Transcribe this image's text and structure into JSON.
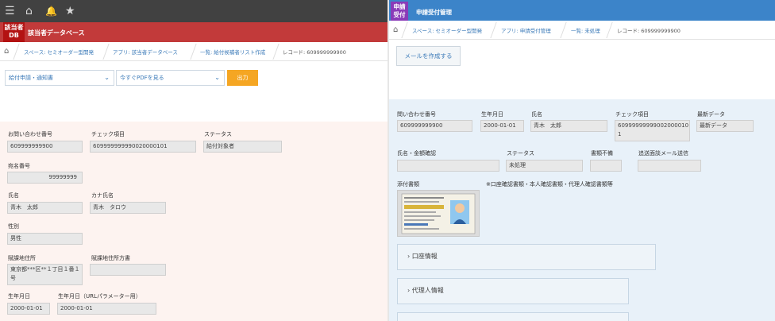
{
  "left": {
    "topbar": {
      "icons": [
        "menu-icon",
        "home-icon",
        "bell-icon",
        "star-icon"
      ],
      "glyphs": [
        "☰",
        "⌂",
        "🔔",
        "★"
      ]
    },
    "app": {
      "icon_line1": "該当者",
      "icon_line2": "DB",
      "title": "該当者データベース"
    },
    "breadcrumb": [
      "スペース: セミオーダー型開発",
      "アプリ: 該当者データベース",
      "一覧: 給付候補者リスト作成",
      "レコード: 609999999900"
    ],
    "controls": {
      "select1": "給付申請・通知書",
      "select2": "今すぐPDFを見る",
      "output_button": "出力"
    },
    "fields": {
      "inquiry_no": {
        "label": "お問い合わせ番号",
        "value": "609999999900"
      },
      "check_item": {
        "label": "チェック項目",
        "value": "609999999990020000101"
      },
      "status": {
        "label": "ステータス",
        "value": "給付対象者"
      },
      "address_no": {
        "label": "宛名番号",
        "value": "99999999"
      },
      "name": {
        "label": "氏名",
        "value": "青木　太郎"
      },
      "kana": {
        "label": "カナ氏名",
        "value": "青木　タロウ"
      },
      "gender": {
        "label": "性別",
        "value": "男性"
      },
      "address": {
        "label": "賦課地住所",
        "value": "東京都***区**１丁目１番１号"
      },
      "address_note": {
        "label": "賦課地住所方書",
        "value": ""
      },
      "birthdate": {
        "label": "生年月日",
        "value": "2000-01-01"
      },
      "birthdate_url": {
        "label": "生年月日（URLパラメーター用）",
        "value": "2000-01-01"
      }
    }
  },
  "right": {
    "app": {
      "icon_line1": "申請",
      "icon_line2": "受付",
      "title": "申請受付管理"
    },
    "breadcrumb": [
      "スペース: セミオーダー型開発",
      "アプリ: 申請受付管理",
      "一覧: 未処理",
      "レコード: 609999999900"
    ],
    "mail_button": "メールを作成する",
    "fields": {
      "inquiry_no": {
        "label": "問い合わせ番号",
        "value": "609999999900"
      },
      "birthdate": {
        "label": "生年月日",
        "value": "2000-01-01"
      },
      "name": {
        "label": "氏名",
        "value": "青木　太郎"
      },
      "check_item": {
        "label": "チェック項目",
        "value": "609999999990020000101"
      },
      "latest": {
        "label": "最新データ",
        "value": "最新データ"
      },
      "name_amount": {
        "label": "氏名・金額確認",
        "value": ""
      },
      "status": {
        "label": "ステータス",
        "value": "未処理"
      },
      "docs_missing": {
        "label": "書類不備",
        "value": ""
      },
      "resend_mail": {
        "label": "追送面談メール送信",
        "value": ""
      }
    },
    "attachments_label": "添付書類",
    "attachments_note": "※口座確認書類・本人確認書類・代理人確認書類等",
    "accordions": [
      "口座情報",
      "代理人情報"
    ]
  }
}
